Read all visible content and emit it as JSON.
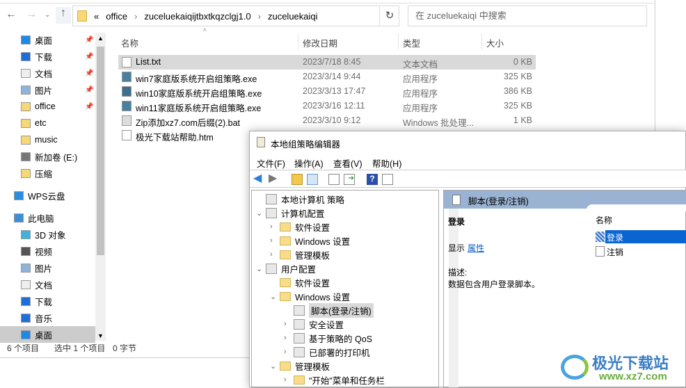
{
  "explorer": {
    "address": {
      "crumbs": [
        "office",
        "zuceluekaiqijtbxtkqzclgj1.0",
        "zuceluekaiqi"
      ],
      "overflow": "«"
    },
    "search_placeholder": "在 zuceluekaiqi 中搜索",
    "sidebar": [
      {
        "label": "桌面",
        "icon": "desktop-icon",
        "pinned": true
      },
      {
        "label": "下载",
        "icon": "download-icon",
        "pinned": true
      },
      {
        "label": "文档",
        "icon": "document-icon",
        "pinned": true
      },
      {
        "label": "图片",
        "icon": "picture-icon",
        "pinned": true
      },
      {
        "label": "office",
        "icon": "folder-icon",
        "pinned": true
      },
      {
        "label": "etc",
        "icon": "folder-icon"
      },
      {
        "label": "music",
        "icon": "folder-icon"
      },
      {
        "label": "新加卷 (E:)",
        "icon": "drive-icon"
      },
      {
        "label": "压缩",
        "icon": "folder-icon"
      },
      {
        "label": "WPS云盘",
        "icon": "cloud-icon"
      },
      {
        "label": "此电脑",
        "icon": "computer-icon"
      },
      {
        "label": "3D 对象",
        "icon": "cube-icon"
      },
      {
        "label": "视频",
        "icon": "video-icon"
      },
      {
        "label": "图片",
        "icon": "picture-icon"
      },
      {
        "label": "文档",
        "icon": "document-icon"
      },
      {
        "label": "下载",
        "icon": "download-icon"
      },
      {
        "label": "音乐",
        "icon": "music-icon"
      },
      {
        "label": "桌面",
        "icon": "desktop-icon"
      }
    ],
    "columns": [
      "名称",
      "修改日期",
      "类型",
      "大小"
    ],
    "files": [
      {
        "name": "List.txt",
        "date": "2023/7/18 8:45",
        "type": "文本文档",
        "size": "0 KB"
      },
      {
        "name": "win7家庭版系统开启组策略.exe",
        "date": "2023/3/14 9:44",
        "type": "应用程序",
        "size": "325 KB"
      },
      {
        "name": "win10家庭版系统开启组策略.exe",
        "date": "2023/3/13 17:47",
        "type": "应用程序",
        "size": "386 KB"
      },
      {
        "name": "win11家庭版系统开启组策略.exe",
        "date": "2023/3/16 12:11",
        "type": "应用程序",
        "size": "325 KB"
      },
      {
        "name": "Zip添加xz7.com后缀(2).bat",
        "date": "2023/3/10 9:12",
        "type": "Windows 批处理...",
        "size": "1 KB"
      },
      {
        "name": "极光下载站帮助.htm",
        "date": "",
        "type": "",
        "size": ""
      }
    ],
    "status": {
      "count": "6 个项目",
      "selected": "选中 1 个项目",
      "size": "0 字节"
    }
  },
  "gpe": {
    "title": "本地组策略编辑器",
    "menu": [
      "文件(F)",
      "操作(A)",
      "查看(V)",
      "帮助(H)"
    ],
    "tree": [
      {
        "label": "本地计算机 策略",
        "level": 0,
        "exp": ""
      },
      {
        "label": "计算机配置",
        "level": 0,
        "exp": "⌄"
      },
      {
        "label": "软件设置",
        "level": 1,
        "exp": "›"
      },
      {
        "label": "Windows 设置",
        "level": 1,
        "exp": "›"
      },
      {
        "label": "管理模板",
        "level": 1,
        "exp": "›"
      },
      {
        "label": "用户配置",
        "level": 0,
        "exp": "⌄"
      },
      {
        "label": "软件设置",
        "level": 1,
        "exp": ""
      },
      {
        "label": "Windows 设置",
        "level": 1,
        "exp": "⌄"
      },
      {
        "label": "脚本(登录/注销)",
        "level": 2,
        "exp": ""
      },
      {
        "label": "安全设置",
        "level": 2,
        "exp": "›"
      },
      {
        "label": "基于策略的 QoS",
        "level": 2,
        "exp": "›"
      },
      {
        "label": "已部署的打印机",
        "level": 2,
        "exp": "›"
      },
      {
        "label": "管理模板",
        "level": 1,
        "exp": "⌄"
      },
      {
        "label": "\"开始\"菜单和任务栏",
        "level": 2,
        "exp": "›"
      }
    ],
    "right": {
      "header": "脚本(登录/注销)",
      "section": "登录",
      "show_label": "显示",
      "properties_link": "属性",
      "desc_label": "描述:",
      "desc": "数据包含用户登录脚本。",
      "list_header": "名称",
      "items": [
        "登录",
        "注销"
      ]
    }
  },
  "watermark": {
    "brand": "极光下载站",
    "url": "www.xz7.com"
  }
}
